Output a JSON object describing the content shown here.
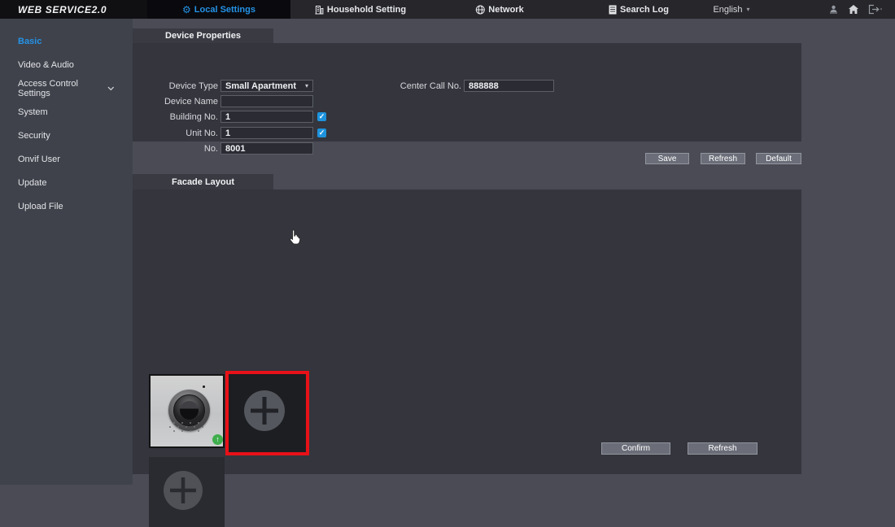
{
  "header": {
    "logo": "WEB SERVICE2.0",
    "tabs": [
      {
        "label": "Local Settings",
        "icon": "gear-icon",
        "active": true
      },
      {
        "label": "Household Setting",
        "icon": "building-icon",
        "active": false
      },
      {
        "label": "Network",
        "icon": "globe-icon",
        "active": false
      },
      {
        "label": "Search Log",
        "icon": "log-icon",
        "active": false
      }
    ],
    "language": {
      "label": "English"
    },
    "right_icons": [
      "user-icon",
      "home-icon",
      "logout-icon"
    ]
  },
  "sidebar": {
    "items": [
      {
        "label": "Basic",
        "active": true
      },
      {
        "label": "Video & Audio",
        "active": false
      },
      {
        "label": "Access Control Settings",
        "active": false,
        "expandable": true
      },
      {
        "label": "System",
        "active": false
      },
      {
        "label": "Security",
        "active": false
      },
      {
        "label": "Onvif User",
        "active": false
      },
      {
        "label": "Update",
        "active": false
      },
      {
        "label": "Upload File",
        "active": false
      }
    ]
  },
  "device_properties": {
    "title": "Device Properties",
    "fields": {
      "device_type": {
        "label": "Device Type",
        "value": "Small Apartment"
      },
      "center_call_no": {
        "label": "Center Call No.",
        "value": "888888"
      },
      "device_name": {
        "label": "Device Name",
        "value": ""
      },
      "building_no": {
        "label": "Building No.",
        "value": "1",
        "checked": true
      },
      "unit_no": {
        "label": "Unit No.",
        "value": "1",
        "checked": true
      },
      "no": {
        "label": "No.",
        "value": "8001"
      }
    },
    "buttons": {
      "save": "Save",
      "refresh": "Refresh",
      "default": "Default"
    }
  },
  "facade_layout": {
    "title": "Facade Layout",
    "tiles": [
      "camera-module",
      "selected-empty-slot",
      "empty-slot"
    ],
    "buttons": {
      "confirm": "Confirm",
      "refresh": "Refresh"
    }
  },
  "icons": {
    "gear": "⚙",
    "check": "✓",
    "caret_down": "▾",
    "arrow_up": "↑"
  },
  "colors": {
    "accent_blue": "#2492e6",
    "selection_red": "#e81118",
    "badge_green": "#3fae4c",
    "checkbox_blue": "#1d93dd"
  }
}
